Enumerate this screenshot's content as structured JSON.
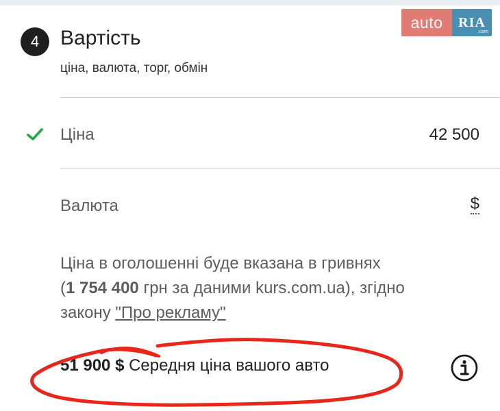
{
  "logo": {
    "auto": "auto",
    "ria": "RIA",
    "ria_suffix": ".com"
  },
  "step": {
    "number": "4",
    "title": "Вартість",
    "subtitle": "ціна, валюта, торг, обмін"
  },
  "price_row": {
    "label": "Ціна",
    "value": "42 500",
    "status_icon": "check-icon",
    "status_color": "#1eaa4a"
  },
  "currency_row": {
    "label": "Валюта",
    "value": "$"
  },
  "notice": {
    "line1": "Ціна в оголошенні буде вказана в гривнях",
    "open_paren": "(",
    "uah_amount": "1 754 400",
    "line2_rest": " грн за даними kurs.com.ua), згідно",
    "line3_prefix": "закону ",
    "law_link": "\"Про рекламу\""
  },
  "average": {
    "amount": "51 900 $",
    "label": " Середня ціна вашого авто",
    "info_icon": "info-icon"
  },
  "colors": {
    "logo_auto": "#e07c74",
    "logo_ria": "#4a8fb1",
    "annotation": "#e8261c"
  }
}
